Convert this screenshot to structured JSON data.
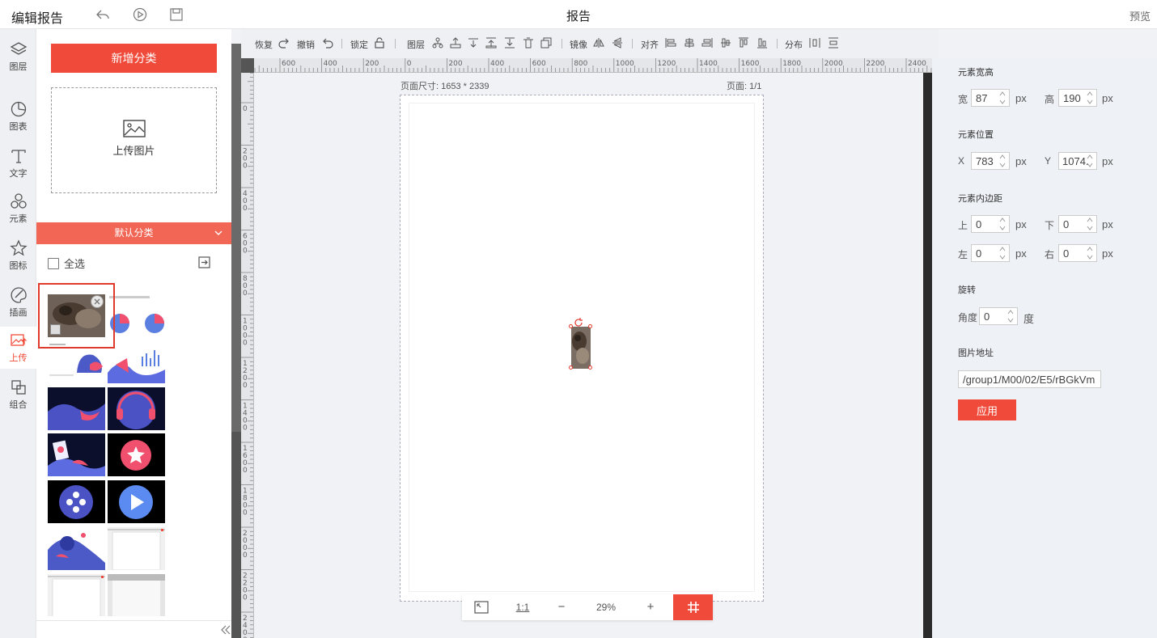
{
  "header": {
    "app_title": "编辑报告",
    "doc_title": "报告",
    "preview": "预览"
  },
  "nav": {
    "items": [
      {
        "label": "图层",
        "icon": "layers-icon"
      },
      {
        "label": "图表",
        "icon": "chart-icon"
      },
      {
        "label": "文字",
        "icon": "text-icon"
      },
      {
        "label": "元素",
        "icon": "shapes-icon"
      },
      {
        "label": "图标",
        "icon": "star-icon"
      },
      {
        "label": "插画",
        "icon": "palette-icon"
      },
      {
        "label": "上传",
        "icon": "upload-image-icon",
        "active": true
      },
      {
        "label": "组合",
        "icon": "group-icon"
      }
    ]
  },
  "panel": {
    "add_category": "新增分类",
    "upload_label": "上传图片",
    "category_name": "默认分类",
    "select_all": "全选"
  },
  "toolbar": {
    "redo": "恢复",
    "undo": "撤销",
    "lock": "锁定",
    "layer": "图层",
    "mirror": "镜像",
    "align": "对齐",
    "distribute": "分布"
  },
  "ruler": {
    "h_ticks": [
      "600",
      "400",
      "200",
      "0",
      "200",
      "400",
      "600",
      "800",
      "1000",
      "1200",
      "1400",
      "1600",
      "1800",
      "2000",
      "2200",
      "2400"
    ],
    "v_ticks": [
      "0",
      "200",
      "400",
      "600",
      "800",
      "1000",
      "1200",
      "1400",
      "1600",
      "1800",
      "2000",
      "2200",
      "2400"
    ]
  },
  "canvas": {
    "page_size": "页面尺寸: 1653 * 2339",
    "page_number": "页面: 1/1"
  },
  "zoom": {
    "one_to_one": "1:1",
    "minus": "−",
    "value": "29%",
    "plus": "+"
  },
  "props": {
    "size_title": "元素宽高",
    "width_label": "宽",
    "width": "87",
    "height_label": "高",
    "height": "190",
    "unit": "px",
    "pos_title": "元素位置",
    "x_label": "X",
    "x": "783",
    "y_label": "Y",
    "y": "1074.5",
    "padding_title": "元素内边距",
    "top_label": "上",
    "top": "0",
    "bottom_label": "下",
    "bottom": "0",
    "left_label": "左",
    "left": "0",
    "right_label": "右",
    "right": "0",
    "rotate_title": "旋转",
    "angle_label": "角度",
    "angle": "0",
    "angle_unit": "度",
    "url_title": "图片地址",
    "url": "/group1/M00/02/E5/rBGkVm",
    "apply": "应用"
  },
  "colors": {
    "accent": "#f04b3a",
    "category_bar": "#f26655"
  }
}
